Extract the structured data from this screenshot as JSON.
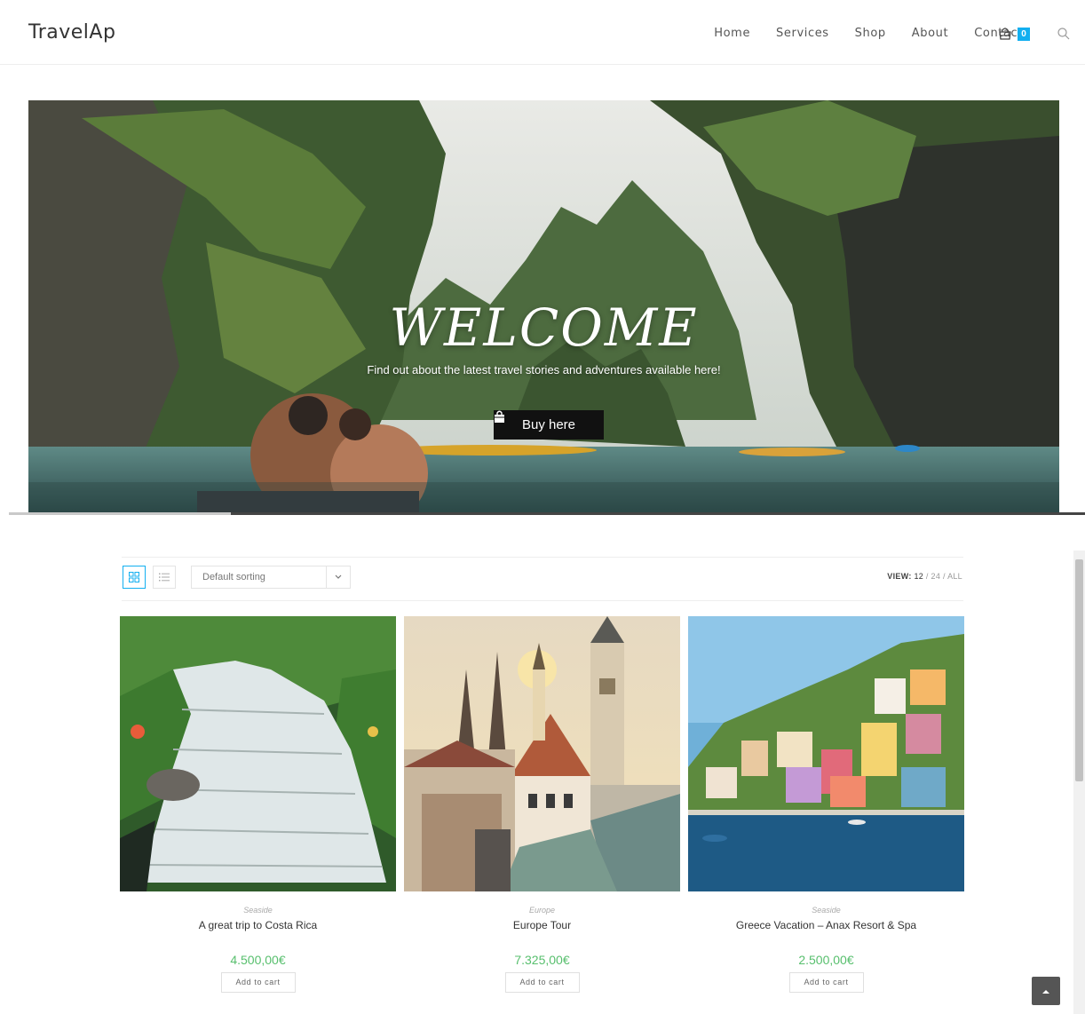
{
  "header": {
    "logo": "TravelAp",
    "nav": [
      "Home",
      "Services",
      "Shop",
      "About",
      "Contact"
    ],
    "cart_count": "0"
  },
  "hero": {
    "title": "WELCOME",
    "subtitle": "Find out about the latest travel stories and adventures available here!",
    "button_label": "Buy here"
  },
  "toolbar": {
    "sort_selected": "Default sorting",
    "view_label": "VIEW:",
    "view_current": "12",
    "view_options": [
      "24",
      "ALL"
    ]
  },
  "products": [
    {
      "category": "Seaside",
      "name": "A great trip to Costa Rica",
      "price": "4.500,00€",
      "button": "Add to cart"
    },
    {
      "category": "Europe",
      "name": "Europe Tour",
      "price": "7.325,00€",
      "button": "Add to cart"
    },
    {
      "category": "Seaside",
      "name": "Greece Vacation – Anax Resort & Spa",
      "price": "2.500,00€",
      "button": "Add to cart"
    }
  ],
  "colors": {
    "accent": "#13aff0",
    "price": "#57bf6d"
  }
}
